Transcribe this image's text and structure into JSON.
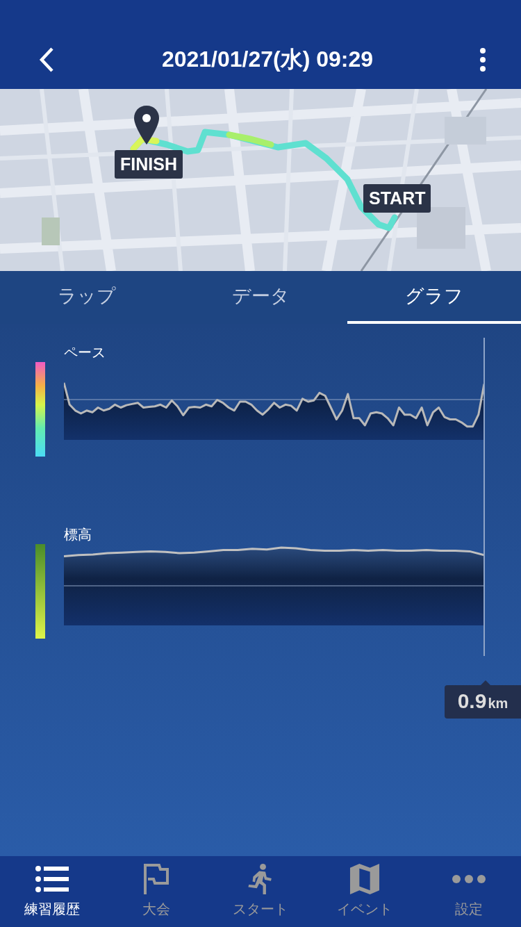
{
  "header": {
    "title": "2021/01/27(水) 09:29"
  },
  "map": {
    "markers": [
      {
        "label": "FINISH",
        "kind": "finish"
      },
      {
        "label": "START",
        "kind": "start"
      }
    ]
  },
  "tabs": [
    {
      "label": "ラップ",
      "selected": false
    },
    {
      "label": "データ",
      "selected": false
    },
    {
      "label": "グラフ",
      "selected": true
    }
  ],
  "graphs": [
    {
      "label": "ペース",
      "kind": "pace"
    },
    {
      "label": "標高",
      "kind": "elevation"
    }
  ],
  "cursor": {
    "value": "0.9",
    "unit": "km"
  },
  "nav": [
    {
      "label": "練習履歴",
      "kind": "list",
      "selected": true
    },
    {
      "label": "大会",
      "kind": "flag",
      "selected": false
    },
    {
      "label": "スタート",
      "kind": "runner",
      "selected": false
    },
    {
      "label": "イベント",
      "kind": "map",
      "selected": false
    },
    {
      "label": "設定",
      "kind": "more",
      "selected": false
    }
  ]
}
